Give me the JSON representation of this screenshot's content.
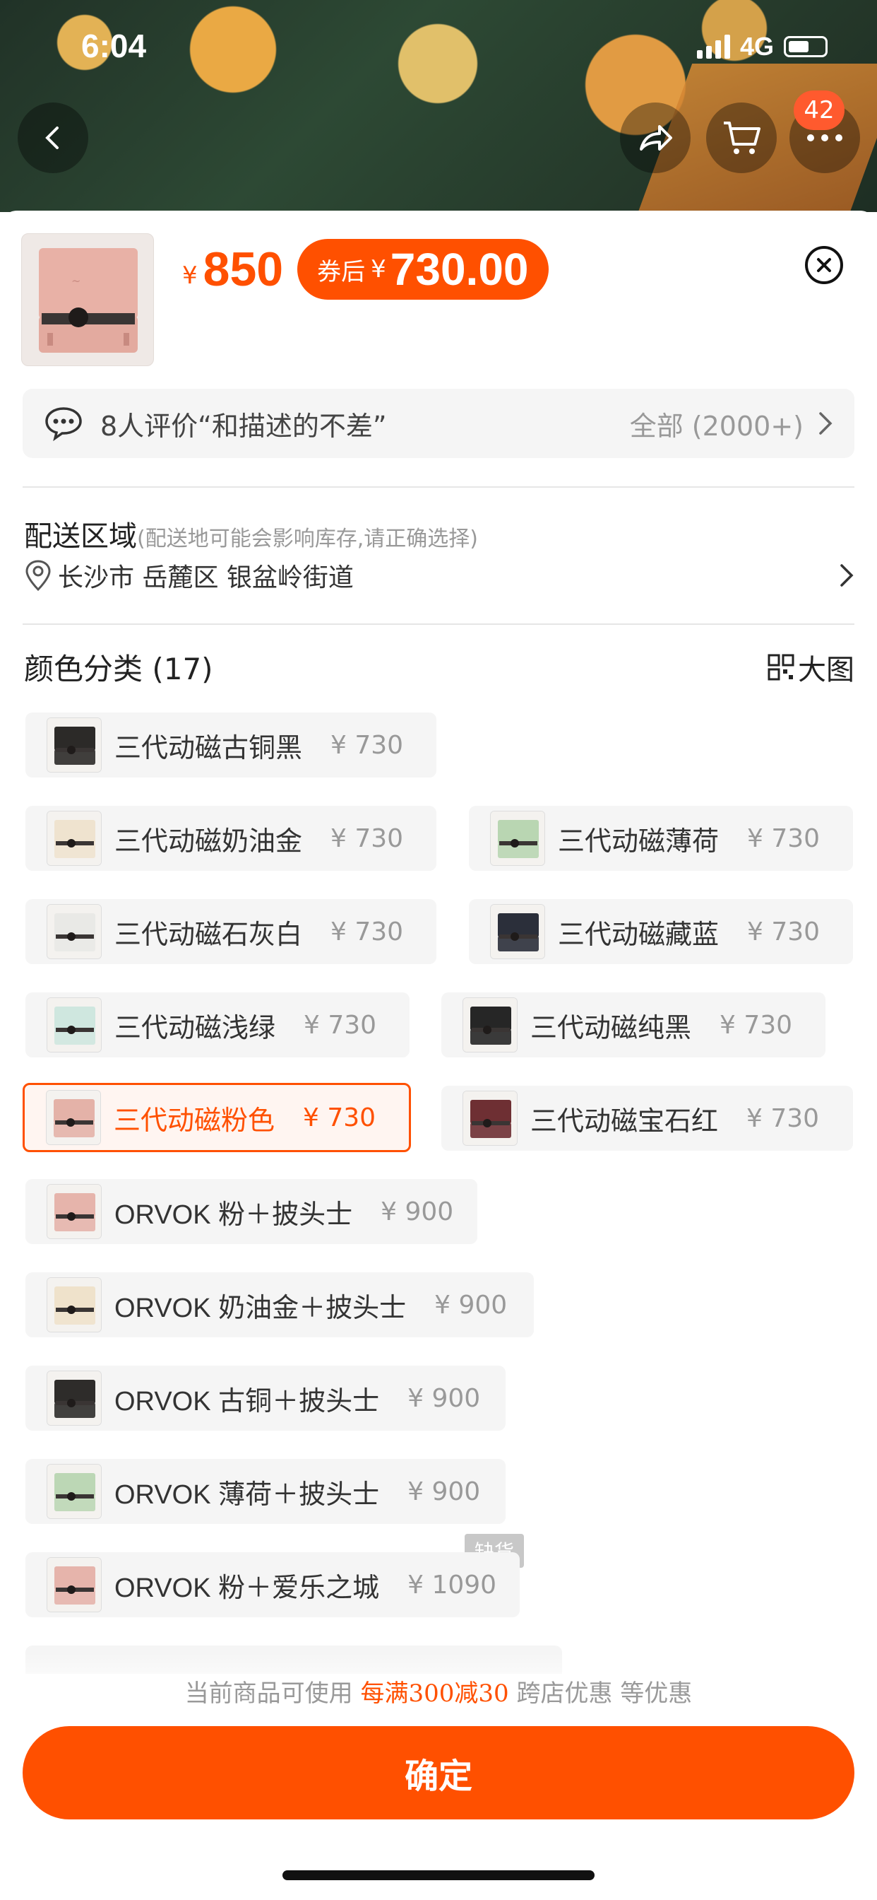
{
  "status_bar": {
    "time": "6:04",
    "network": "4G"
  },
  "nav": {
    "badge_count": "42"
  },
  "product": {
    "price_symbol": "¥",
    "price": "850",
    "coupon_label": "券后",
    "coupon_symbol": "¥",
    "coupon_price": "730.00"
  },
  "review": {
    "text": "8人评价“和描述的不差”",
    "all_label": "全部 (2000+)"
  },
  "shipping": {
    "title": "配送区域",
    "note": "(配送地可能会影响库存,请正确选择)",
    "address": "长沙市 岳麓区 银盆岭街道"
  },
  "color_section": {
    "title": "颜色分类 (17)",
    "big_image_label": "大图"
  },
  "options": [
    {
      "name": "三代动磁古铜黑",
      "price": "¥ 730",
      "thumb_color": "#2c2a28"
    },
    {
      "name": "三代动磁奶油金",
      "price": "¥ 730",
      "thumb_color": "#efe3cf"
    },
    {
      "name": "三代动磁薄荷",
      "price": "¥ 730",
      "thumb_color": "#b9d6b2"
    },
    {
      "name": "三代动磁石灰白",
      "price": "¥ 730",
      "thumb_color": "#e9e9e6"
    },
    {
      "name": "三代动磁藏蓝",
      "price": "¥ 730",
      "thumb_color": "#2b2f3a"
    },
    {
      "name": "三代动磁浅绿",
      "price": "¥ 730",
      "thumb_color": "#cfe7df"
    },
    {
      "name": "三代动磁纯黑",
      "price": "¥ 730",
      "thumb_color": "#262626"
    },
    {
      "name": "三代动磁粉色",
      "price": "¥ 730",
      "thumb_color": "#e4b2a8",
      "selected": true
    },
    {
      "name": "三代动磁宝石红",
      "price": "¥ 730",
      "thumb_color": "#6e2f33"
    },
    {
      "name": "ORVOK 粉＋披头士",
      "price": "¥ 900",
      "thumb_color": "#e6b4ab"
    },
    {
      "name": "ORVOK 奶油金＋披头士",
      "price": "¥ 900",
      "thumb_color": "#efe2cb"
    },
    {
      "name": "ORVOK 古铜＋披头士",
      "price": "¥ 900",
      "thumb_color": "#2e2c2a"
    },
    {
      "name": "ORVOK 薄荷＋披头士",
      "price": "¥ 900",
      "thumb_color": "#bcd7b5"
    },
    {
      "name": "ORVOK 粉＋爱乐之城",
      "price": "¥ 1090",
      "thumb_color": "#e6b4ab"
    }
  ],
  "out_of_stock_label": "缺货",
  "promo": {
    "prefix": "当前商品可使用",
    "highlight": "每满300减30",
    "suffix": "跨店优惠 等优惠"
  },
  "confirm_label": "确定",
  "colors": {
    "accent": "#ff5000"
  }
}
